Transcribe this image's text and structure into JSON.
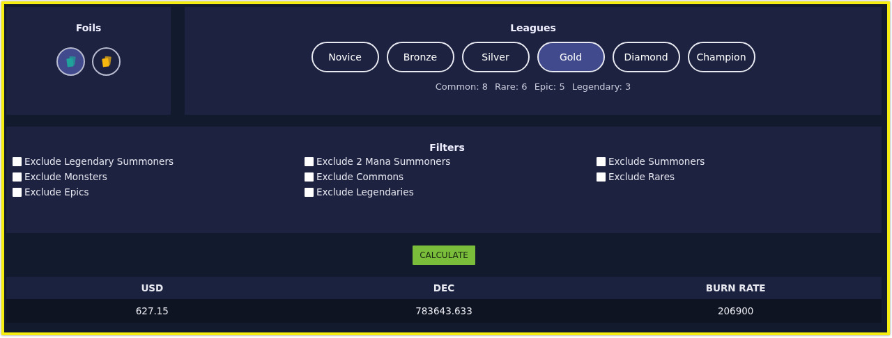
{
  "foils": {
    "title": "Foils",
    "options": [
      {
        "selected": true,
        "color": "#1fa39a"
      },
      {
        "selected": false,
        "color": "#f5b70f"
      }
    ]
  },
  "leagues": {
    "title": "Leagues",
    "options": [
      {
        "label": "Novice",
        "selected": false
      },
      {
        "label": "Bronze",
        "selected": false
      },
      {
        "label": "Silver",
        "selected": false
      },
      {
        "label": "Gold",
        "selected": true
      },
      {
        "label": "Diamond",
        "selected": false
      },
      {
        "label": "Champion",
        "selected": false
      }
    ],
    "counts": [
      "Common: 8",
      "Rare: 6",
      "Epic: 5",
      "Legendary: 3"
    ]
  },
  "filters": {
    "title": "Filters",
    "items": [
      {
        "label": "Exclude Legendary Summoners",
        "checked": false
      },
      {
        "label": "Exclude 2 Mana Summoners",
        "checked": false
      },
      {
        "label": "Exclude Summoners",
        "checked": false
      },
      {
        "label": "Exclude Monsters",
        "checked": false
      },
      {
        "label": "Exclude Commons",
        "checked": false
      },
      {
        "label": "Exclude Rares",
        "checked": false
      },
      {
        "label": "Exclude Epics",
        "checked": false
      },
      {
        "label": "Exclude Legendaries",
        "checked": false
      }
    ]
  },
  "calculate_button": "CALCULATE",
  "table": {
    "columns": [
      "USD",
      "DEC",
      "BURN RATE"
    ],
    "rows": [
      [
        "627.15",
        "783643.633",
        "206900"
      ]
    ]
  }
}
